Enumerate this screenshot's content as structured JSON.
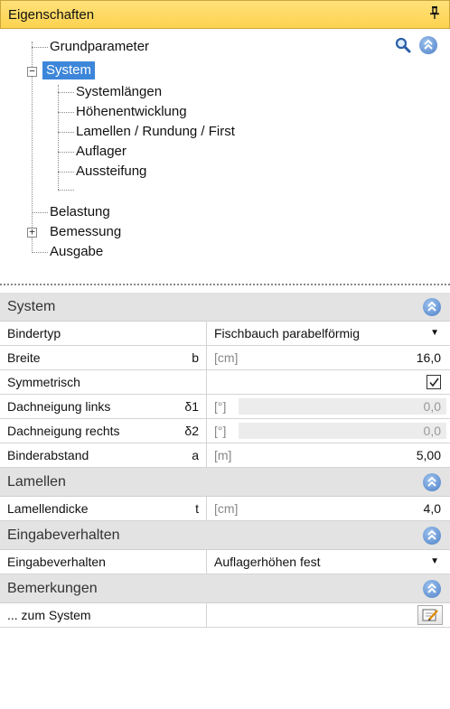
{
  "panel": {
    "title": "Eigenschaften",
    "pin_icon": "pin-icon"
  },
  "tree": {
    "items": [
      {
        "label": "Grundparameter"
      },
      {
        "label": "System"
      },
      {
        "label": "Systemlängen"
      },
      {
        "label": "Höhenentwicklung"
      },
      {
        "label": "Lamellen / Rundung / First"
      },
      {
        "label": "Auflager"
      },
      {
        "label": "Aussteifung"
      },
      {
        "label": "Belastung"
      },
      {
        "label": "Bemessung"
      },
      {
        "label": "Ausgabe"
      }
    ],
    "expander_system": "−",
    "expander_bemessung": "+"
  },
  "sections": {
    "system": "System",
    "lamellen": "Lamellen",
    "eingabe": "Eingabeverhalten",
    "bemerkungen": "Bemerkungen"
  },
  "rows": {
    "bindertyp": {
      "name": "Bindertyp",
      "value": "Fischbauch parabelförmig"
    },
    "breite": {
      "name": "Breite",
      "sym": "b",
      "unit": "[cm]",
      "value": "16,0"
    },
    "symmetrisch": {
      "name": "Symmetrisch",
      "checked": true
    },
    "dn_links": {
      "name": "Dachneigung links",
      "sym": "δ1",
      "unit": "[°]",
      "value": "0,0"
    },
    "dn_rechts": {
      "name": "Dachneigung rechts",
      "sym": "δ2",
      "unit": "[°]",
      "value": "0,0"
    },
    "binderabstand": {
      "name": "Binderabstand",
      "sym": "a",
      "unit": "[m]",
      "value": "5,00"
    },
    "lamellendicke": {
      "name": "Lamellendicke",
      "sym": "t",
      "unit": "[cm]",
      "value": "4,0"
    },
    "eingabeverhalten": {
      "name": "Eingabeverhalten",
      "value": "Auflagerhöhen fest"
    },
    "zum_system": {
      "name": "... zum System"
    }
  },
  "colors": {
    "title_bar": "#fdd24f",
    "selection": "#3d86d9",
    "section_bg": "#e3e3e3"
  }
}
